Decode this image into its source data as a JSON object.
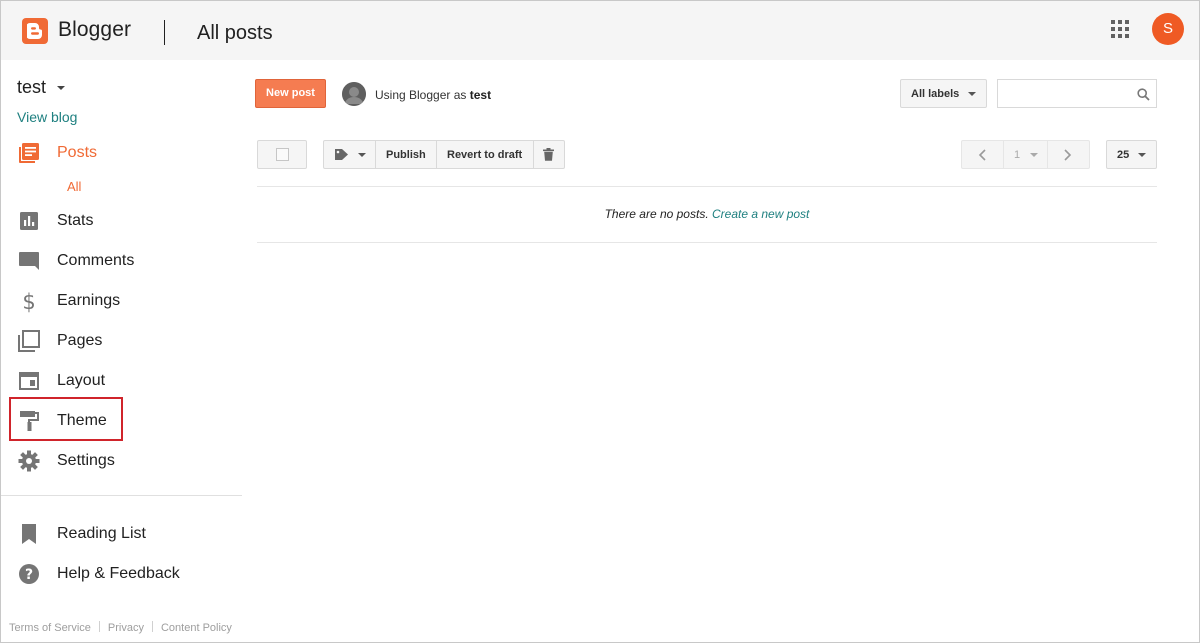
{
  "header": {
    "brand": "Blogger",
    "page_title": "All posts",
    "avatar_initial": "S",
    "accent_color": "#f06a35"
  },
  "sidebar": {
    "blog_name": "test",
    "view_blog": "View blog",
    "items": [
      {
        "label": "Posts",
        "icon": "posts-icon",
        "active": true
      },
      {
        "label": "Stats",
        "icon": "stats-icon"
      },
      {
        "label": "Comments",
        "icon": "comments-icon"
      },
      {
        "label": "Earnings",
        "icon": "dollar-icon"
      },
      {
        "label": "Pages",
        "icon": "pages-icon"
      },
      {
        "label": "Layout",
        "icon": "layout-icon"
      },
      {
        "label": "Theme",
        "icon": "paint-roller-icon",
        "highlighted": true
      },
      {
        "label": "Settings",
        "icon": "gear-icon"
      },
      {
        "label": "Reading List",
        "icon": "bookmark-icon"
      },
      {
        "label": "Help & Feedback",
        "icon": "help-icon"
      }
    ],
    "posts_sub": "All",
    "footer": [
      "Terms of Service",
      "Privacy",
      "Content Policy"
    ]
  },
  "toolbar": {
    "new_post": "New post",
    "using_prefix": "Using Blogger as ",
    "using_user": "test",
    "labels_button": "All labels",
    "search_placeholder": ""
  },
  "actions": {
    "publish": "Publish",
    "revert": "Revert to draft",
    "page_number": "1",
    "per_page": "25"
  },
  "posts": {
    "empty_text": "There are no posts.",
    "create_link": "Create a new post"
  }
}
